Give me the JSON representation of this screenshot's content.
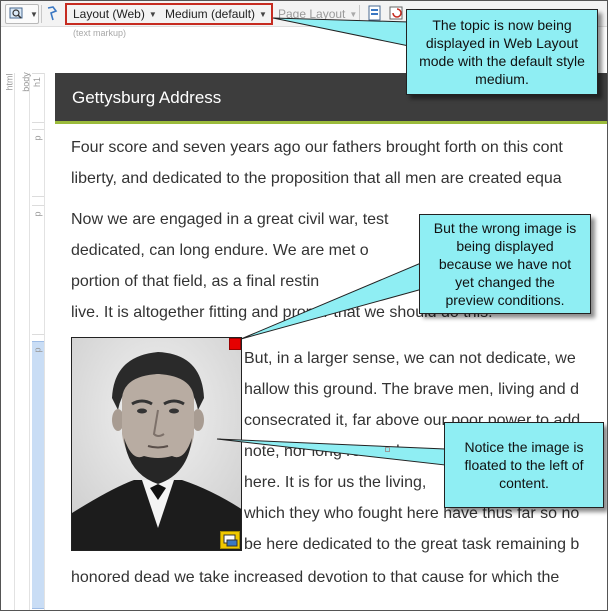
{
  "toolbar": {
    "layout_dropdown": "Layout (Web)",
    "medium_dropdown": "Medium (default)",
    "page_layout_dropdown": "Page Layout",
    "markup_label": "(text markup)"
  },
  "ruler": {
    "tags": [
      "html",
      "body",
      "h1",
      "p",
      "p",
      "p",
      "p"
    ]
  },
  "document": {
    "title": "Gettysburg Address",
    "lines": [
      "Four score and seven years ago our fathers brought forth on this cont",
      "liberty, and dedicated to the proposition that all men are created equa",
      "Now we are engaged in a great civil war, test",
      "dedicated, can long endure. We are met o",
      "portion of that field, as a final restin",
      "live. It is altogether fitting and proper that we should do this.",
      "But, in a larger sense, we can not dedicate, we",
      "hallow this ground. The brave men, living and d",
      "consecrated it, far above our poor power to add",
      "note, nor long remember",
      "here. It is for us the living,",
      "which they who fought here have thus far so no",
      "be here dedicated to the great task remaining b",
      "honored dead we take increased devotion to that cause for which the"
    ]
  },
  "callouts": {
    "top": "The topic is now being displayed in Web Layout mode with the default style medium.",
    "middle": "But the wrong image is being displayed because we have not yet changed the preview conditions.",
    "bottom": "Notice the image is floated to the left of content."
  },
  "colors": {
    "title_bar": "#3d3d3d",
    "title_underline": "#9bbb3b",
    "callout_fill": "#8feef3",
    "highlight_border": "#c62b20"
  },
  "icons": [
    "preview-icon",
    "help-icon",
    "chevron-down-icon",
    "page-icon",
    "refresh-icon",
    "resize-handle-icon",
    "image-badge-icon"
  ]
}
